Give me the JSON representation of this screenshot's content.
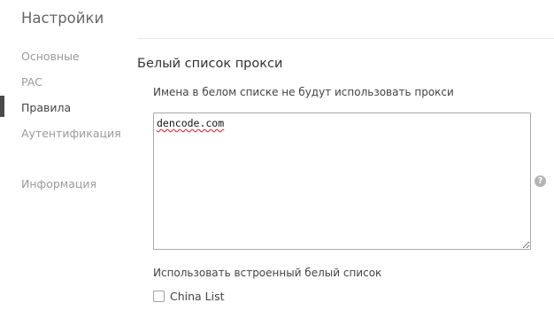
{
  "app": {
    "title": "Настройки"
  },
  "sidebar": {
    "items": [
      {
        "label": "Основные",
        "active": false
      },
      {
        "label": "PAC",
        "active": false
      },
      {
        "label": "Правила",
        "active": true
      },
      {
        "label": "Аутентификация",
        "active": false
      },
      {
        "label": "Информация",
        "active": false
      }
    ]
  },
  "main": {
    "section_title": "Белый список прокси",
    "whitelist": {
      "label": "Имена в белом списке не будут использовать прокси",
      "value": "dencode.com",
      "help_icon": "question-circle-icon",
      "help_glyph": "?"
    },
    "builtin": {
      "label": "Использовать встроенный белый список",
      "options": [
        {
          "label": "China List",
          "checked": false
        }
      ]
    }
  },
  "colors": {
    "active_indicator": "#4a4a4a",
    "nav_inactive": "#9a9a9a",
    "spellcheck_underline": "#e23c3c",
    "help_icon_bg": "#b4b4b4"
  }
}
